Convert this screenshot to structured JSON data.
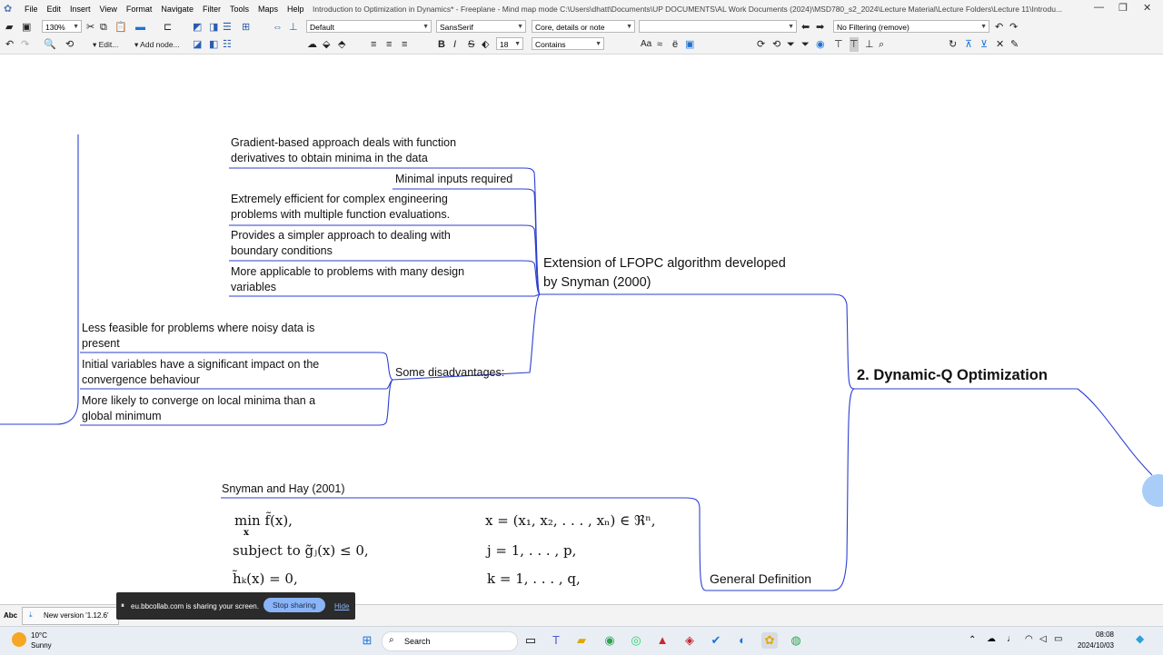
{
  "app": {
    "title": "Introduction to Optimization in Dynamics* - Freeplane - Mind map mode C:\\Users\\dhatt\\Documents\\UP DOCUMENTS\\AL Work Documents (2024)\\MSD780_s2_2024\\Lecture Material\\Lecture Folders\\Lecture 11\\Introdu...",
    "menu": [
      "File",
      "Edit",
      "Insert",
      "View",
      "Format",
      "Navigate",
      "Filter",
      "Tools",
      "Maps",
      "Help"
    ]
  },
  "toolbar": {
    "zoom": "130%",
    "edit_label": "Edit...",
    "add_node_label": "Add node...",
    "style": "Default",
    "font": "SansSerif",
    "font_size": "18",
    "view_mode": "Core, details or note",
    "search_text": "",
    "match_mode": "Contains",
    "filter": "No Filtering (remove)",
    "case_label": "Aa"
  },
  "mindmap": {
    "root": "2.  Dynamic-Q Optimization",
    "branch_extension": {
      "label_line1": "Extension of LFOPC algorithm developed",
      "label_line2": "by Snyman (2000)",
      "children": [
        {
          "l1": "Gradient-based approach deals with function",
          "l2": "derivatives to obtain minima in the data"
        },
        {
          "l1": "Minimal inputs required",
          "l2": ""
        },
        {
          "l1": "Extremely efficient for complex engineering",
          "l2": "problems with multiple function evaluations."
        },
        {
          "l1": "Provides a simpler approach to dealing with",
          "l2": "boundary conditions"
        },
        {
          "l1": "More applicable to problems with many design",
          "l2": "variables"
        }
      ],
      "disadvantages": {
        "label": "Some disadvantages:",
        "children": [
          {
            "l1": "Less feasible for problems where noisy data is",
            "l2": "present"
          },
          {
            "l1": "Initial variables have a significant impact on the",
            "l2": "convergence behaviour"
          },
          {
            "l1": "More likely to converge on local minima than a",
            "l2": "global minimum"
          }
        ]
      }
    },
    "branch_general": {
      "label": "General Definition",
      "source": "Snyman and Hay (2001)",
      "math": {
        "r1_left": "min f̃(x),",
        "r1_sub": "x",
        "r1_right": "x = (x₁, x₂, . . . , xₙ) ∈ ℜⁿ,",
        "r2_left": "subject to g̃ⱼ(x) ≤ 0,",
        "r2_right": "j = 1, . . . , p,",
        "r3_left": "h̃ₖ(x) = 0,",
        "r3_right": "k = 1, . . . , q,"
      }
    }
  },
  "sharing": {
    "message": "eu.bbcollab.com is sharing your screen.",
    "stop": "Stop sharing",
    "hide": "Hide"
  },
  "status": {
    "abc": "Abc",
    "new_version": "New version '1.12.6'"
  },
  "taskbar": {
    "weather_temp": "10°C",
    "weather_desc": "Sunny",
    "search": "Search",
    "time": "08:08",
    "date": "2024/10/03"
  },
  "colors": {
    "link": "#2d3fcf",
    "toolbar_bg": "#f3f3f3",
    "accent": "#8ab4f8"
  }
}
